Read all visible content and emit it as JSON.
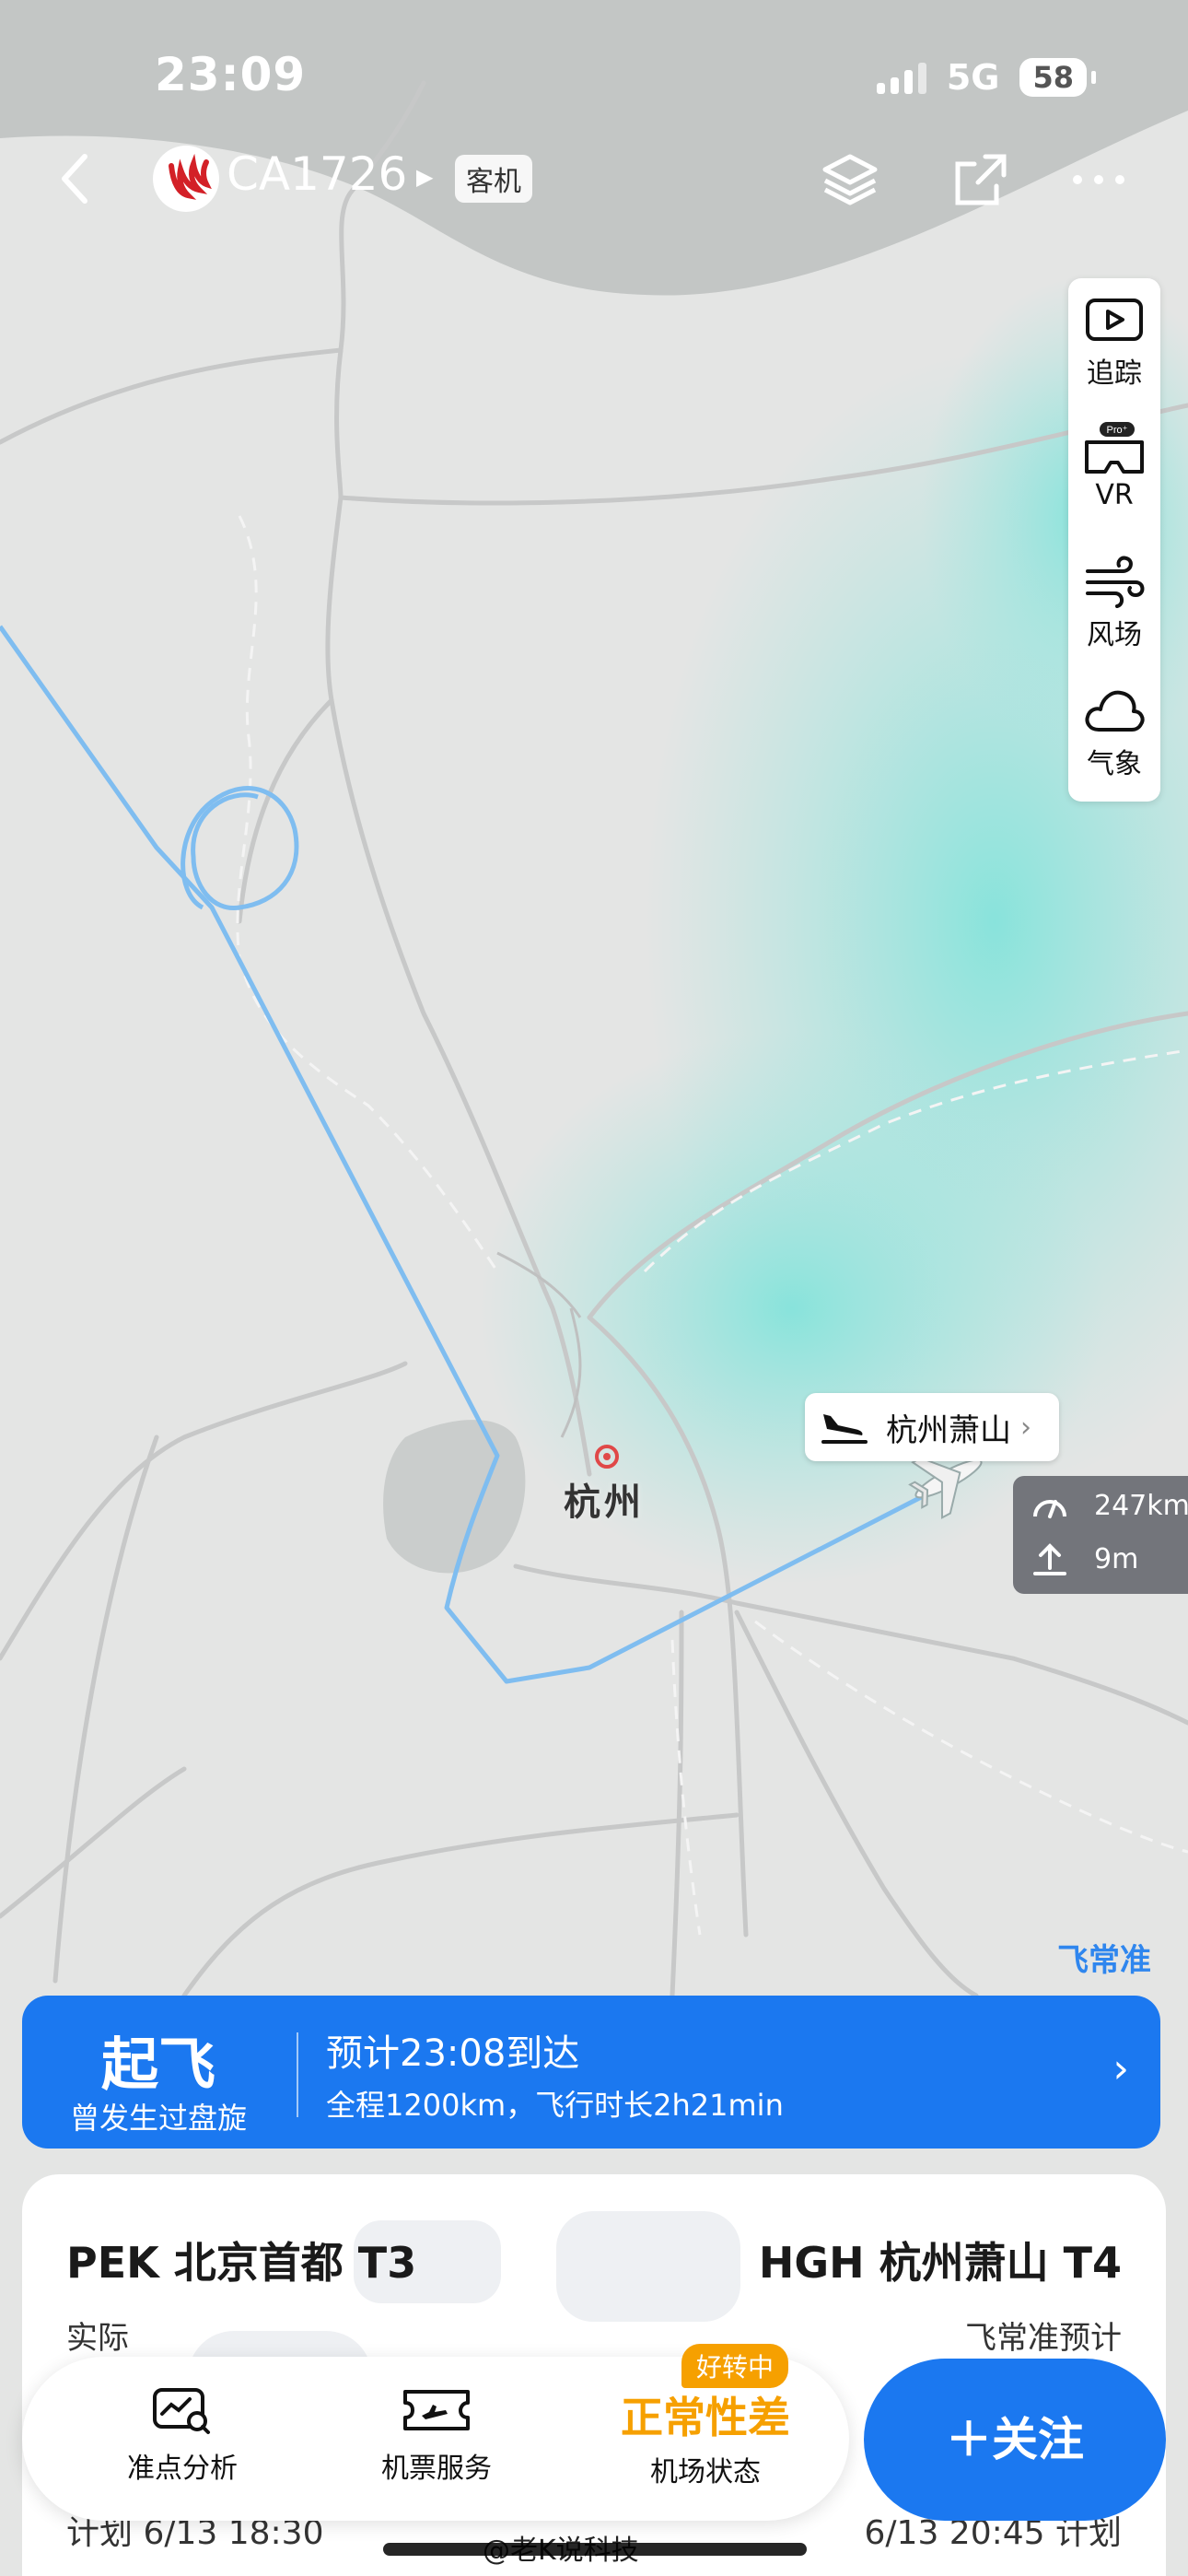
{
  "status_bar": {
    "time": "23:09",
    "network": "5G",
    "battery": "58"
  },
  "header": {
    "flight_number": "CA1726",
    "aircraft_type": "客机",
    "icons": [
      "back-arrow-icon",
      "airline-logo",
      "layers-icon",
      "share-icon",
      "more-icon"
    ]
  },
  "side_tools": [
    {
      "label": "追踪",
      "icon": "video-track-icon"
    },
    {
      "label": "VR",
      "icon": "vr-headset-icon",
      "badge": "Pro⁺"
    },
    {
      "label": "风场",
      "icon": "wind-icon"
    },
    {
      "label": "气象",
      "icon": "cloud-icon"
    }
  ],
  "map": {
    "city_label": "杭州",
    "destination_tag": "杭州萧山",
    "ground_speed": "247km",
    "altitude": "9m",
    "brand": "飞常准"
  },
  "flight_status": {
    "status": "起飞",
    "note": "曾发生过盘旋",
    "eta": "预计23:08到达",
    "route_info": "全程1200km，飞行时长2h21min"
  },
  "route": {
    "departure": "PEK 北京首都 T3",
    "arrival": "HGH 杭州萧山 T4",
    "dep_time_label": "实际",
    "arr_time_label": "飞常准预计",
    "dep_scheduled": "计划 6/13 18:30",
    "arr_scheduled": "6/13 20:45 计划"
  },
  "bottom_bar": {
    "punctuality_label": "准点分析",
    "tickets_label": "机票服务",
    "airport_status": "正常性差",
    "airport_status_label": "机场状态",
    "improving_badge": "好转中",
    "follow_label": "＋关注"
  },
  "watermark": "@老K说科技",
  "colors": {
    "accent": "#1b78f0",
    "route_line": "#7fbdf0",
    "warning": "#f6a000",
    "sea": "#c6c9c9",
    "weather": "#8fe0da"
  }
}
